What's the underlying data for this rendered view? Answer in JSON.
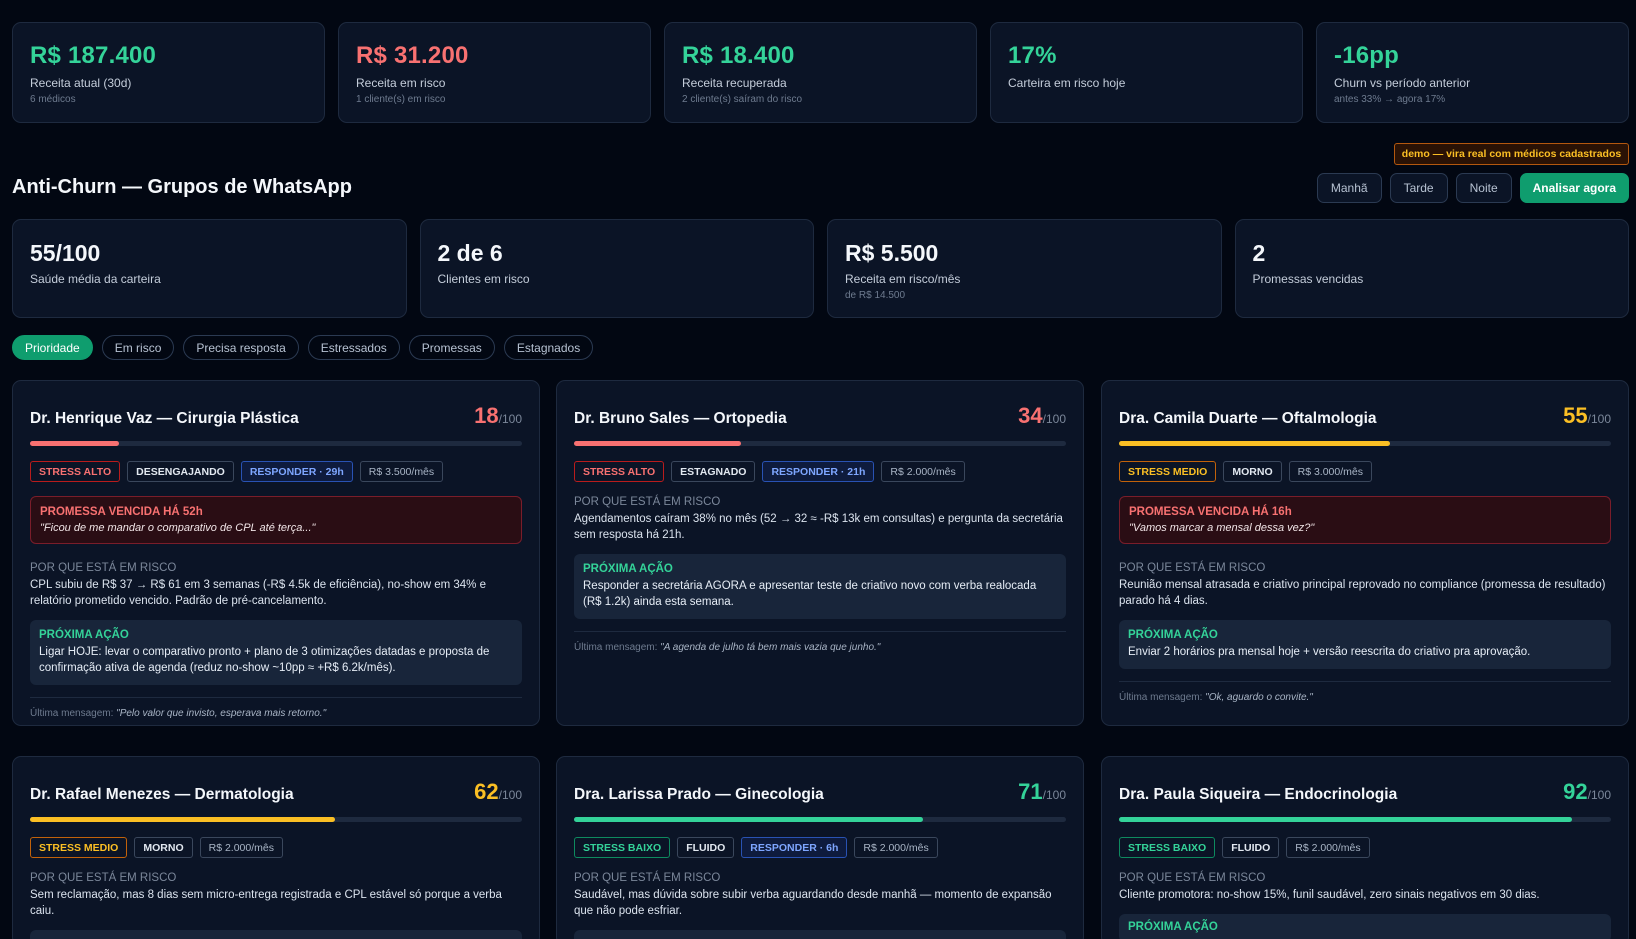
{
  "kpis": [
    {
      "value": "R$ 187.400",
      "label": "Receita atual (30d)",
      "sub": "6 médicos",
      "color": "#34d399"
    },
    {
      "value": "R$ 31.200",
      "label": "Receita em risco",
      "sub": "1 cliente(s) em risco",
      "color": "#f87171"
    },
    {
      "value": "R$ 18.400",
      "label": "Receita recuperada",
      "sub": "2 cliente(s) saíram do risco",
      "color": "#34d399"
    },
    {
      "value": "17%",
      "label": "Carteira em risco hoje",
      "sub": "",
      "color": "#34d399"
    },
    {
      "value": "-16pp",
      "label": "Churn vs período anterior",
      "sub": "antes 33% → agora 17%",
      "color": "#34d399"
    }
  ],
  "demo_badge": "demo — vira real com médicos cadastrados",
  "section_title": "Anti-Churn — Grupos de WhatsApp",
  "period_buttons": {
    "morning": "Manhã",
    "afternoon": "Tarde",
    "night": "Noite",
    "analyze": "Analisar agora"
  },
  "stats": [
    {
      "value": "55/100",
      "label": "Saúde média da carteira",
      "sub": ""
    },
    {
      "value": "2 de 6",
      "label": "Clientes em risco",
      "sub": ""
    },
    {
      "value": "R$ 5.500",
      "label": "Receita em risco/mês",
      "sub": "de R$ 14.500"
    },
    {
      "value": "2",
      "label": "Promessas vencidas",
      "sub": ""
    }
  ],
  "filters": [
    "Prioridade",
    "Em risco",
    "Precisa resposta",
    "Estressados",
    "Promessas",
    "Estagnados"
  ],
  "active_filter": "Prioridade",
  "labels": {
    "score_denominator": "/100",
    "why_title": "POR QUE ESTÁ EM RISCO",
    "next_title": "PRÓXIMA AÇÃO",
    "last_message": "Última mensagem:"
  },
  "clients": [
    {
      "name": "Dr. Henrique Vaz — Cirurgia Plástica",
      "score": "18",
      "score_pct": 18,
      "score_color": "#f87171",
      "tags": [
        {
          "text": "STRESS ALTO",
          "kind": "t-red"
        },
        {
          "text": "DESENGAJANDO",
          "kind": ""
        },
        {
          "text": "RESPONDER · 29h",
          "kind": "t-blue"
        },
        {
          "text": "R$ 3.500/mês",
          "kind": "t-money"
        }
      ],
      "promise_title": "PROMESSA VENCIDA HÁ 52h",
      "promise_quote": "\"Ficou de me mandar o comparativo de CPL até terça...\"",
      "why": "CPL subiu de R$ 37 → R$ 61 em 3 semanas (-R$ 4.5k de eficiência), no-show em 34% e relatório prometido vencido. Padrão de pré-cancelamento.",
      "next": "Ligar HOJE: levar o comparativo pronto + plano de 3 otimizações datadas e proposta de confirmação ativa de agenda (reduz no-show ~10pp ≈ +R$ 6.2k/mês).",
      "last": "\"Pelo valor que invisto, esperava mais retorno.\""
    },
    {
      "name": "Dr. Bruno Sales — Ortopedia",
      "score": "34",
      "score_pct": 34,
      "score_color": "#f87171",
      "tags": [
        {
          "text": "STRESS ALTO",
          "kind": "t-red"
        },
        {
          "text": "ESTAGNADO",
          "kind": ""
        },
        {
          "text": "RESPONDER · 21h",
          "kind": "t-blue"
        },
        {
          "text": "R$ 2.000/mês",
          "kind": "t-money"
        }
      ],
      "promise_title": "",
      "promise_quote": "",
      "why": "Agendamentos caíram 38% no mês (52 → 32 ≈ -R$ 13k em consultas) e pergunta da secretária sem resposta há 21h.",
      "next": "Responder a secretária AGORA e apresentar teste de criativo novo com verba realocada (R$ 1.2k) ainda esta semana.",
      "last": "\"A agenda de julho tá bem mais vazia que junho.\""
    },
    {
      "name": "Dra. Camila Duarte — Oftalmologia",
      "score": "55",
      "score_pct": 55,
      "score_color": "#fbbf24",
      "tags": [
        {
          "text": "STRESS MEDIO",
          "kind": "t-orange"
        },
        {
          "text": "MORNO",
          "kind": ""
        },
        {
          "text": "R$ 3.000/mês",
          "kind": "t-money"
        }
      ],
      "promise_title": "PROMESSA VENCIDA HÁ 16h",
      "promise_quote": "\"Vamos marcar a mensal dessa vez?\"",
      "why": "Reunião mensal atrasada e criativo principal reprovado no compliance (promessa de resultado) parado há 4 dias.",
      "next": "Enviar 2 horários pra mensal hoje + versão reescrita do criativo pra aprovação.",
      "last": "\"Ok, aguardo o convite.\""
    },
    {
      "name": "Dr. Rafael Menezes — Dermatologia",
      "score": "62",
      "score_pct": 62,
      "score_color": "#fbbf24",
      "tags": [
        {
          "text": "STRESS MEDIO",
          "kind": "t-orange"
        },
        {
          "text": "MORNO",
          "kind": ""
        },
        {
          "text": "R$ 2.000/mês",
          "kind": "t-money"
        }
      ],
      "promise_title": "",
      "promise_quote": "",
      "why": "Sem reclamação, mas 8 dias sem micro-entrega registrada e CPL estável só porque a verba caiu.",
      "next": "",
      "last": ""
    },
    {
      "name": "Dra. Larissa Prado — Ginecologia",
      "score": "71",
      "score_pct": 71,
      "score_color": "#34d399",
      "tags": [
        {
          "text": "STRESS BAIXO",
          "kind": "t-green"
        },
        {
          "text": "FLUIDO",
          "kind": ""
        },
        {
          "text": "RESPONDER · 6h",
          "kind": "t-blue"
        },
        {
          "text": "R$ 2.000/mês",
          "kind": "t-money"
        }
      ],
      "promise_title": "",
      "promise_quote": "",
      "why": "Saudável, mas dúvida sobre subir verba aguardando desde manhã — momento de expansão que não pode esfriar.",
      "next": "",
      "last": ""
    },
    {
      "name": "Dra. Paula Siqueira — Endocrinologia",
      "score": "92",
      "score_pct": 92,
      "score_color": "#34d399",
      "tags": [
        {
          "text": "STRESS BAIXO",
          "kind": "t-green"
        },
        {
          "text": "FLUIDO",
          "kind": ""
        },
        {
          "text": "R$ 2.000/mês",
          "kind": "t-money"
        }
      ],
      "promise_title": "",
      "promise_quote": "",
      "why": "Cliente promotora: no-show 15%, funil saudável, zero sinais negativos em 30 dias.",
      "next": "",
      "next_title_visible": true,
      "last": ""
    }
  ]
}
